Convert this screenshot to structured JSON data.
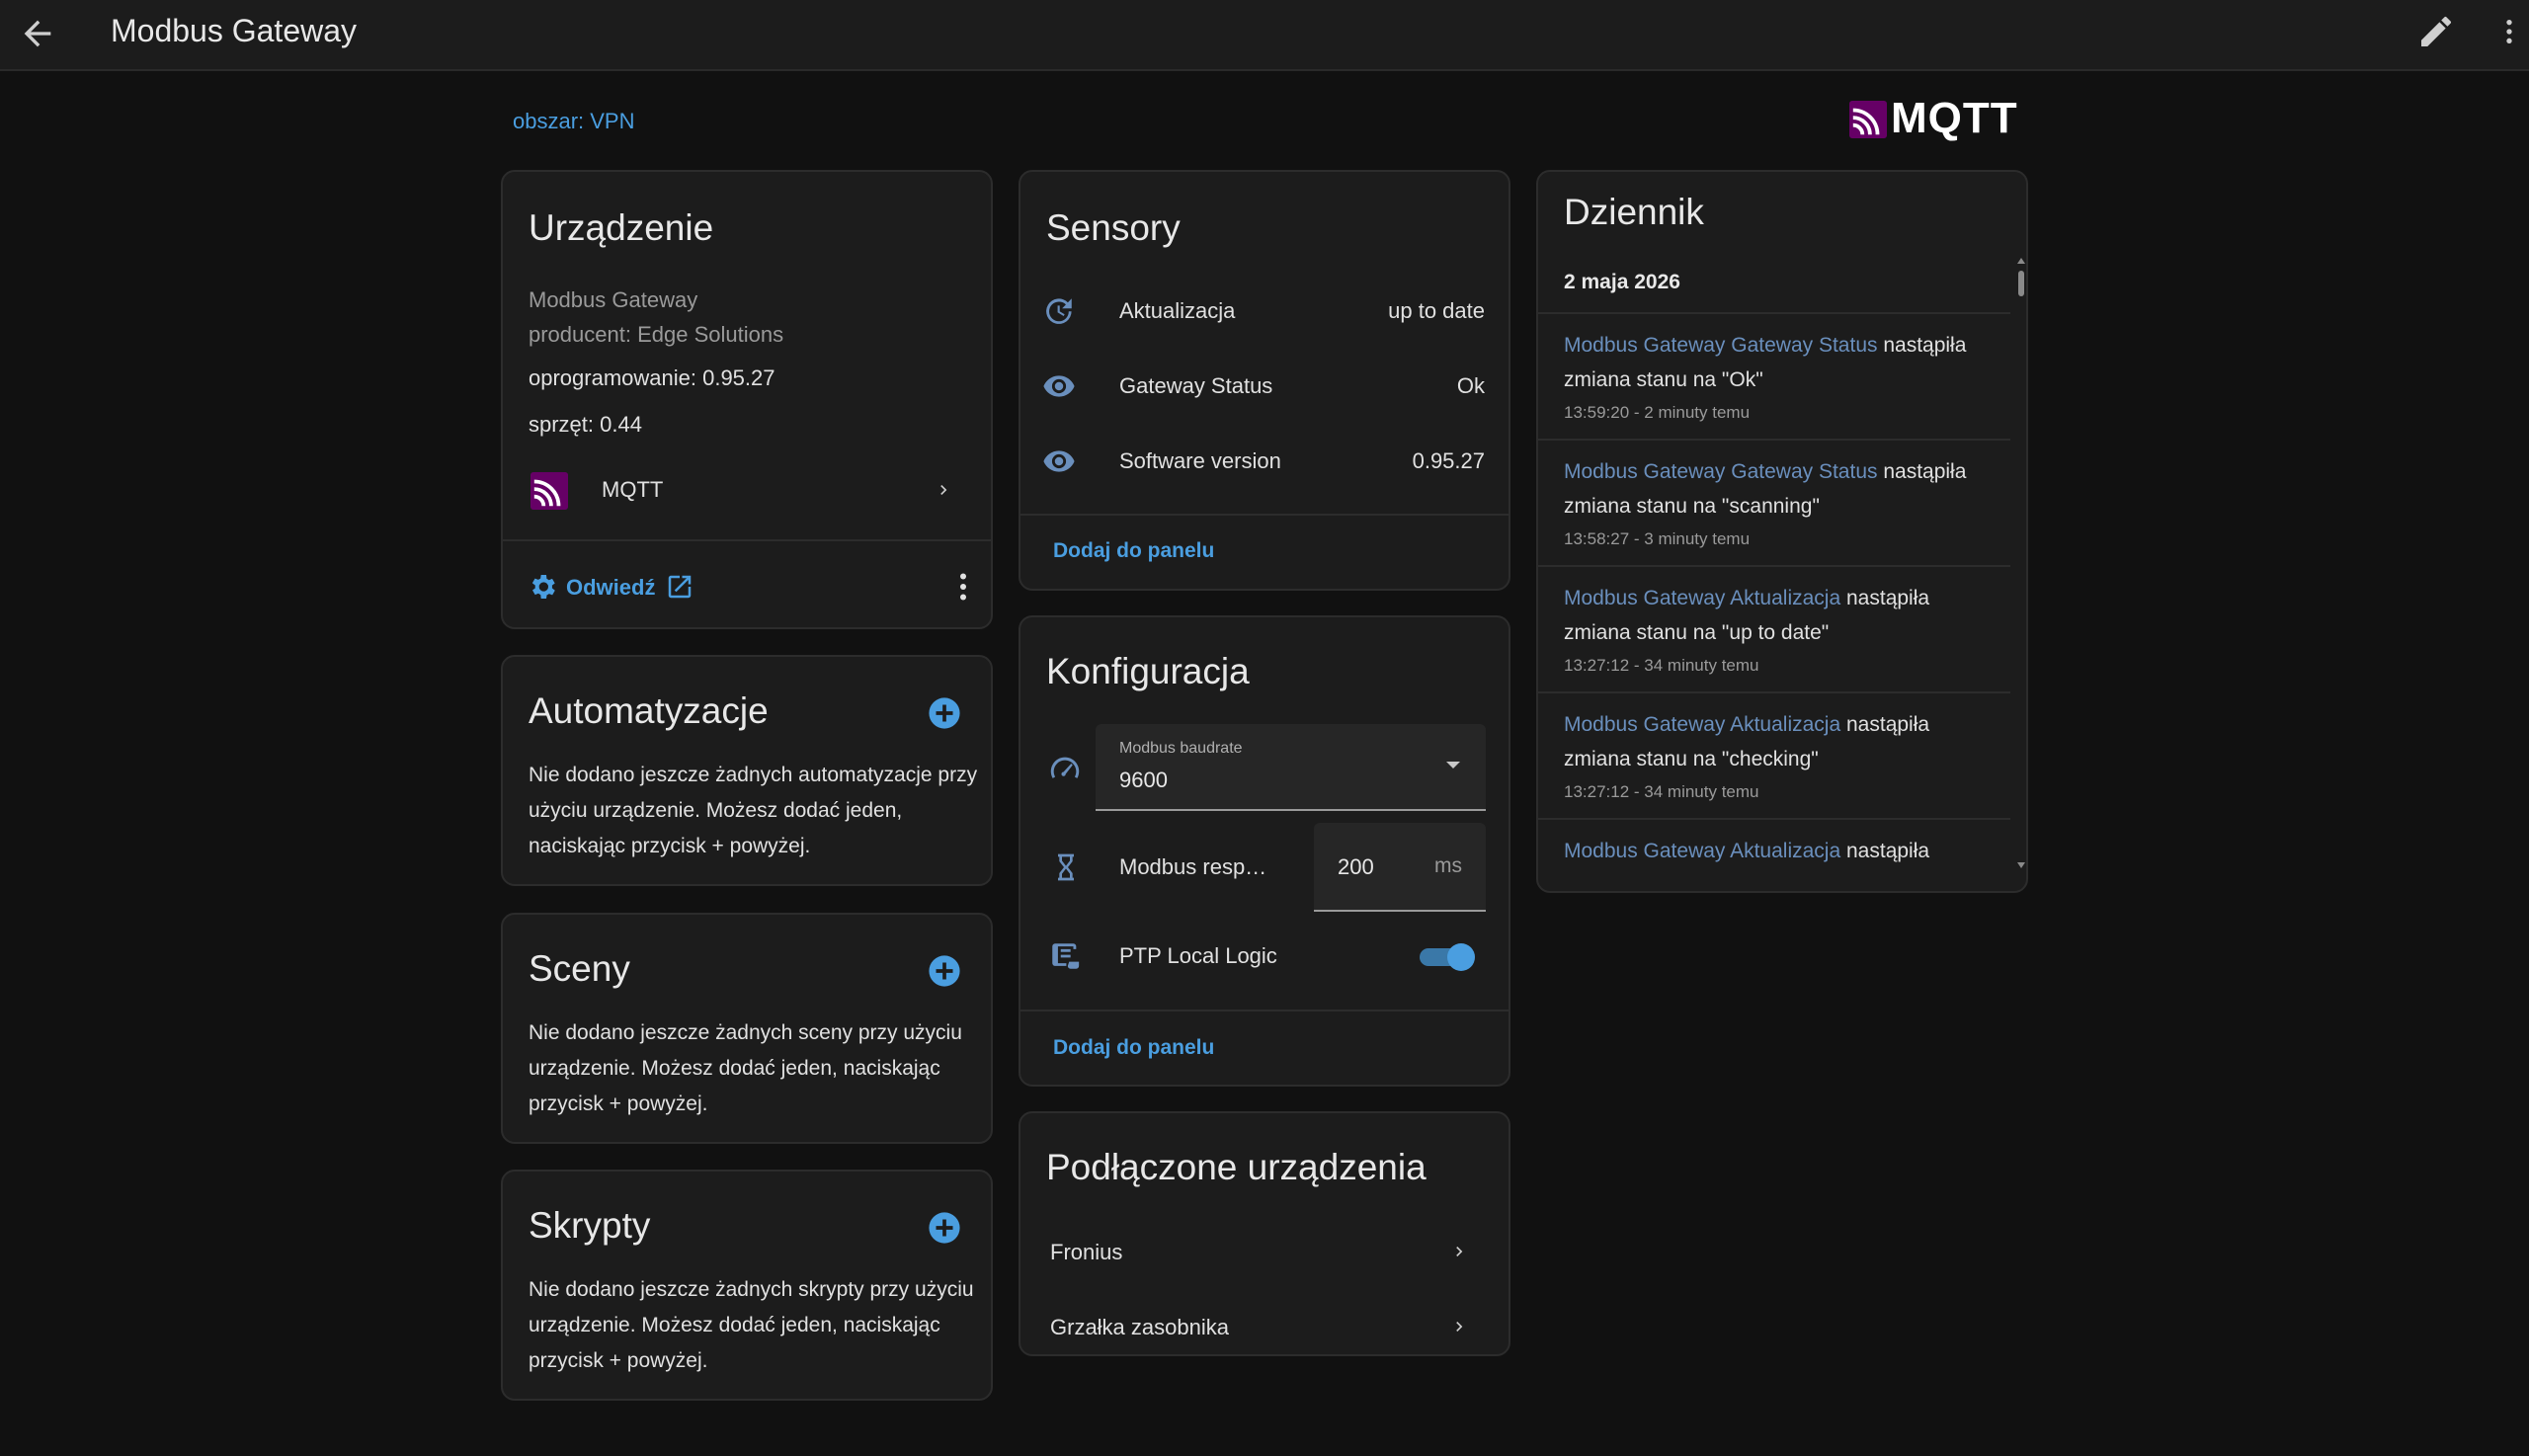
{
  "header": {
    "title": "Modbus Gateway"
  },
  "area_link": "obszar: VPN",
  "logo": {
    "text": "MQTT"
  },
  "colors": {
    "accent": "#4a9ee0",
    "mqtt_purple": "#660066",
    "background": "#111111",
    "card": "#1c1c1c"
  },
  "device": {
    "title": "Urządzenie",
    "model": "Modbus Gateway",
    "manufacturer": "producent: Edge Solutions",
    "firmware": "oprogramowanie: 0.95.27",
    "hardware": "sprzęt: 0.44",
    "integration_label": "MQTT",
    "visit_label": "Odwiedź"
  },
  "automations": {
    "title": "Automatyzacje",
    "text": "Nie dodano jeszcze żadnych automatyzacje przy użyciu urządzenie. Możesz dodać jeden, naciskając przycisk + powyżej."
  },
  "scenes": {
    "title": "Sceny",
    "text": "Nie dodano jeszcze żadnych sceny przy użyciu urządzenie. Możesz dodać jeden, naciskając przycisk + powyżej."
  },
  "scripts": {
    "title": "Skrypty",
    "text": "Nie dodano jeszcze żadnych skrypty przy użyciu urządzenie. Możesz dodać jeden, naciskając przycisk + powyżej."
  },
  "sensors": {
    "title": "Sensory",
    "rows": [
      {
        "icon": "update-icon",
        "name": "Aktualizacja",
        "value": "up to date"
      },
      {
        "icon": "eye-icon",
        "name": "Gateway Status",
        "value": "Ok"
      },
      {
        "icon": "eye-icon",
        "name": "Software version",
        "value": "0.95.27"
      }
    ],
    "add_label": "Dodaj do panelu"
  },
  "config": {
    "title": "Konfiguracja",
    "baudrate": {
      "label": "Modbus baudrate",
      "value": "9600"
    },
    "response": {
      "name": "Modbus resp…",
      "value": "200",
      "unit": "ms"
    },
    "ptp": {
      "name": "PTP Local Logic",
      "enabled": true
    },
    "add_label": "Dodaj do panelu"
  },
  "connected": {
    "title": "Podłączone urządzenia",
    "items": [
      {
        "name": "Fronius"
      },
      {
        "name": "Grzałka zasobnika"
      }
    ]
  },
  "logbook": {
    "title": "Dziennik",
    "date": "2 maja 2026",
    "entries": [
      {
        "entity": "Modbus Gateway Gateway Status",
        "action": "nastąpiła zmiana stanu na \"Ok\"",
        "time": "13:59:20 - 2 minuty temu"
      },
      {
        "entity": "Modbus Gateway Gateway Status",
        "action": "nastąpiła zmiana stanu na \"scanning\"",
        "time": "13:58:27 - 3 minuty temu"
      },
      {
        "entity": "Modbus Gateway Aktualizacja",
        "action": "nastąpiła zmiana stanu na \"up to date\"",
        "time": "13:27:12 - 34 minuty temu"
      },
      {
        "entity": "Modbus Gateway Aktualizacja",
        "action": "nastąpiła zmiana stanu na \"checking\"",
        "time": "13:27:12 - 34 minuty temu"
      },
      {
        "entity": "Modbus Gateway Aktualizacja",
        "action": "nastąpiła",
        "time": ""
      }
    ]
  }
}
